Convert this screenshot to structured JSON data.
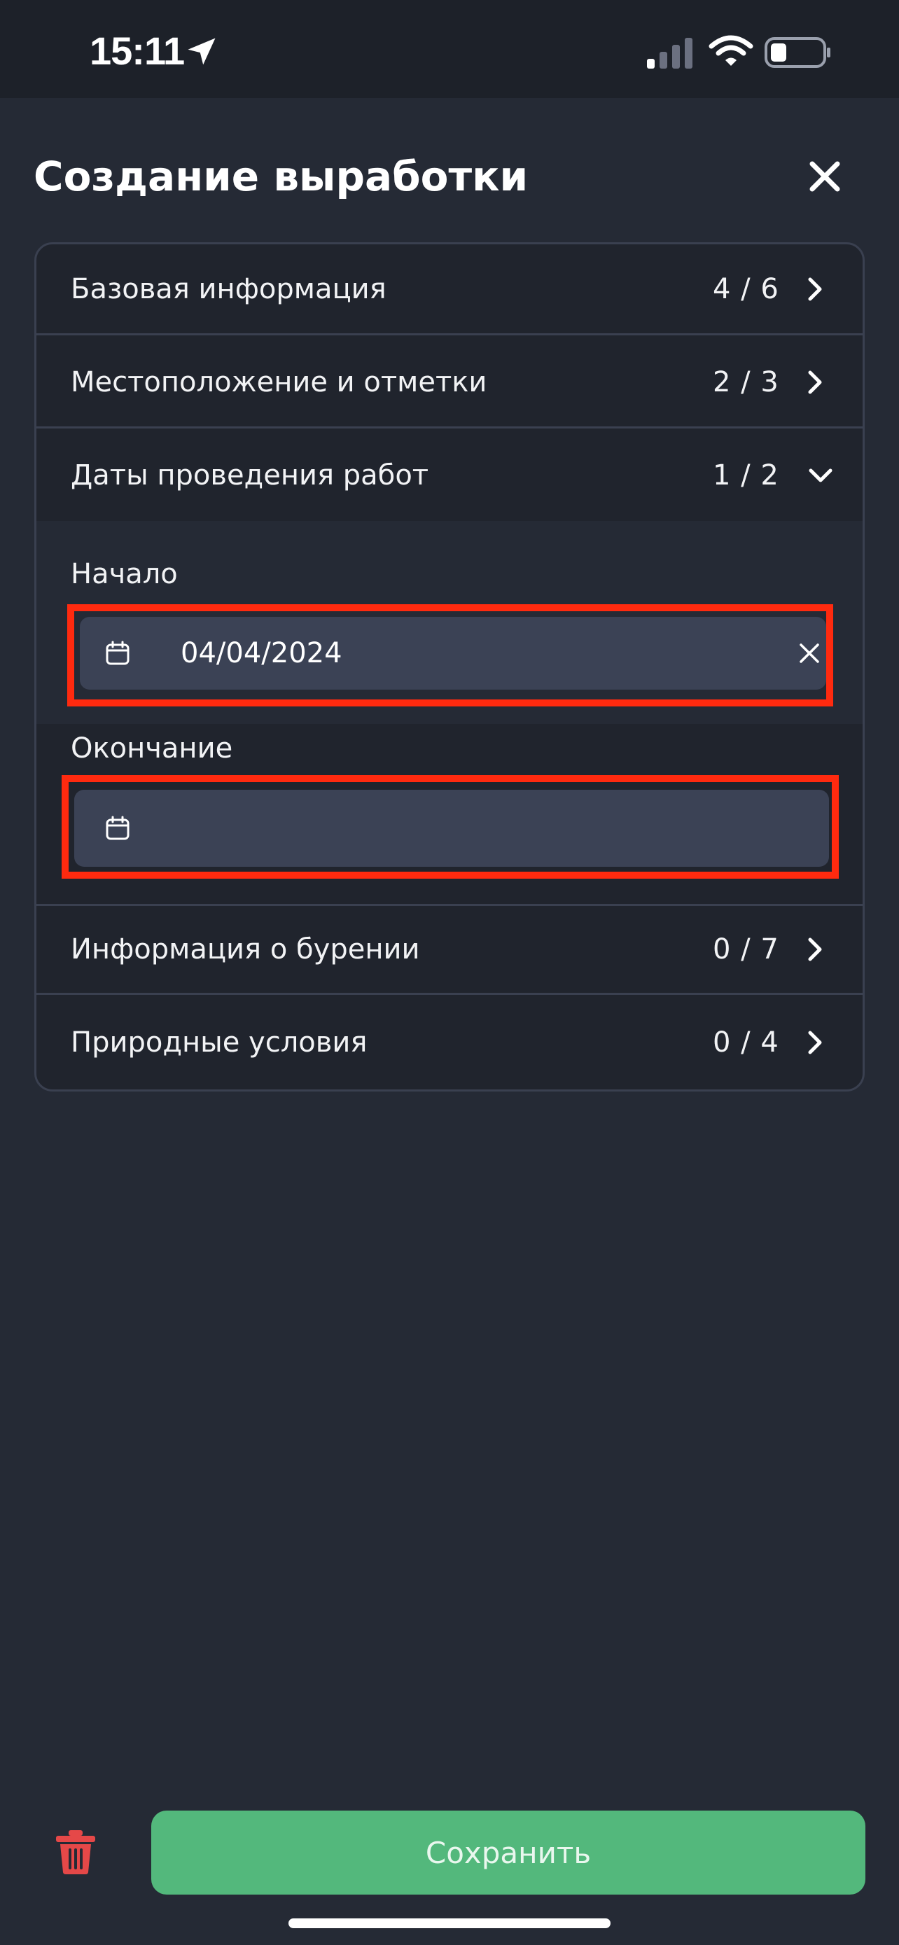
{
  "status_bar": {
    "time": "15:11"
  },
  "header": {
    "title": "Создание выработки"
  },
  "sections": [
    {
      "label": "Базовая информация",
      "count": "4 / 6",
      "state": "collapsed"
    },
    {
      "label": "Местоположение и отметки",
      "count": "2 / 3",
      "state": "collapsed"
    },
    {
      "label": "Даты проведения работ",
      "count": "1 / 2",
      "state": "expanded"
    },
    {
      "label": "Информация о бурении",
      "count": "0 / 7",
      "state": "collapsed"
    },
    {
      "label": "Природные условия",
      "count": "0 / 4",
      "state": "collapsed"
    }
  ],
  "dates": {
    "start_label": "Начало",
    "start_value": "04/04/2024",
    "end_label": "Окончание",
    "end_value": ""
  },
  "footer": {
    "save_label": "Сохранить"
  },
  "colors": {
    "background": "#252a35",
    "card": "#20242d",
    "input": "#3b4255",
    "accent_save": "#53b87c",
    "delete": "#e54848",
    "highlight": "#ff2a0f"
  },
  "icons": {
    "close": "close-icon",
    "chevron_right": "chevron-right-icon",
    "chevron_down": "chevron-down-icon",
    "calendar": "calendar-icon",
    "clear": "clear-icon",
    "delete": "trash-icon"
  }
}
